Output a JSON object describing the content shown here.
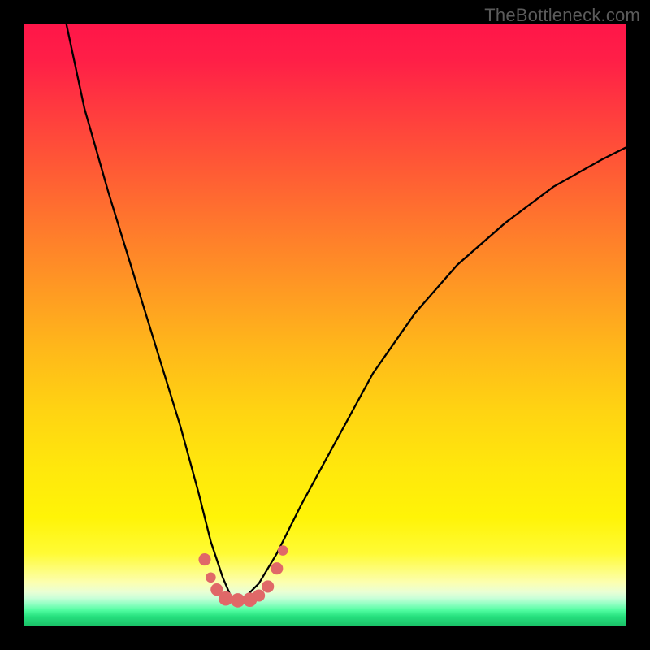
{
  "watermark": "TheBottleneck.com",
  "chart_data": {
    "type": "line",
    "title": "",
    "xlabel": "",
    "ylabel": "",
    "xlim": [
      0,
      100
    ],
    "ylim": [
      0,
      100
    ],
    "series": [
      {
        "name": "bottleneck-curve",
        "x": [
          7,
          10,
          14,
          18,
          22,
          26,
          29,
          31,
          33,
          34.5,
          36.5,
          39,
          42,
          46,
          52,
          58,
          65,
          72,
          80,
          88,
          96,
          100
        ],
        "values": [
          100,
          86,
          72,
          59,
          46,
          33,
          22,
          14,
          8,
          4.5,
          4.5,
          7,
          12,
          20,
          31,
          42,
          52,
          60,
          67,
          73,
          77.5,
          79.5
        ]
      }
    ],
    "markers": {
      "name": "highlight-dots",
      "color": "#e06868",
      "points": [
        {
          "x": 30.0,
          "y": 11.0,
          "r": 1.2
        },
        {
          "x": 31.0,
          "y": 8.0,
          "r": 1.0
        },
        {
          "x": 32.0,
          "y": 6.0,
          "r": 1.2
        },
        {
          "x": 33.5,
          "y": 4.5,
          "r": 1.4
        },
        {
          "x": 35.5,
          "y": 4.2,
          "r": 1.4
        },
        {
          "x": 37.5,
          "y": 4.3,
          "r": 1.4
        },
        {
          "x": 39.0,
          "y": 5.0,
          "r": 1.2
        },
        {
          "x": 40.5,
          "y": 6.5,
          "r": 1.2
        },
        {
          "x": 42.0,
          "y": 9.5,
          "r": 1.2
        },
        {
          "x": 43.0,
          "y": 12.5,
          "r": 1.0
        }
      ]
    },
    "background": {
      "type": "vertical-gradient",
      "stops": [
        {
          "pos": 0,
          "color": "#ff1649"
        },
        {
          "pos": 0.5,
          "color": "#ffb81a"
        },
        {
          "pos": 0.82,
          "color": "#fff407"
        },
        {
          "pos": 0.95,
          "color": "#caffd8"
        },
        {
          "pos": 1.0,
          "color": "#1bc268"
        }
      ]
    }
  }
}
